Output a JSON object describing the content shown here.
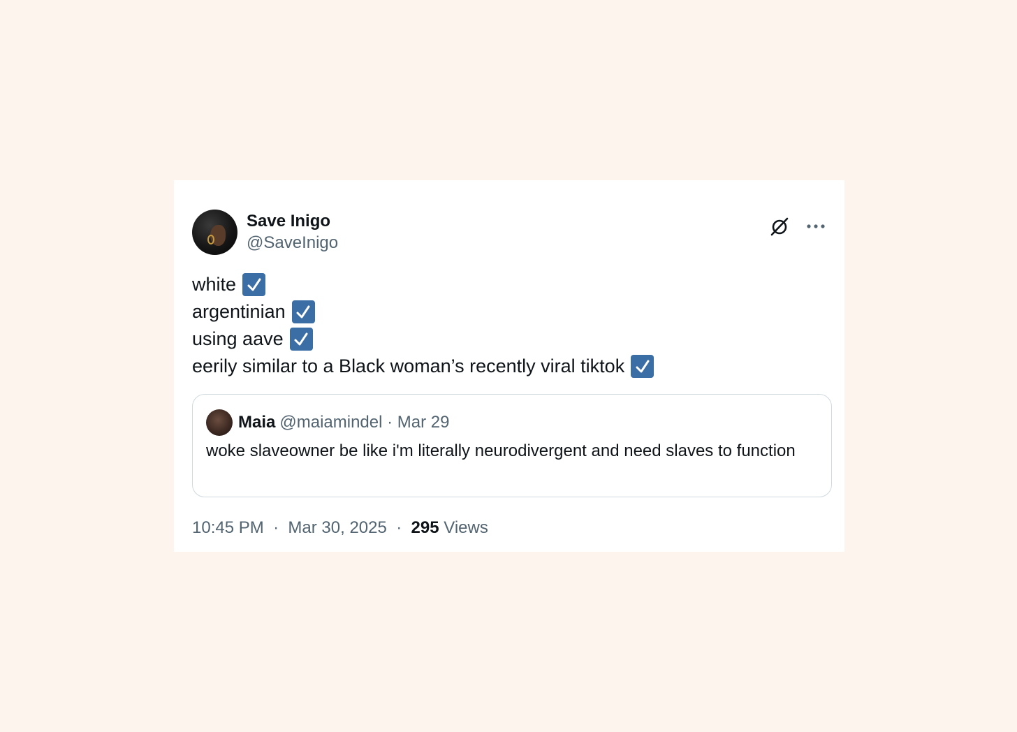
{
  "tweet": {
    "author": {
      "display_name": "Save Inigo",
      "handle": "@SaveInigo"
    },
    "header_icons": [
      "grok-icon",
      "more-icon"
    ],
    "lines": [
      "white",
      "argentinian",
      "using aave",
      "eerily similar to a Black woman’s recently viral tiktok"
    ],
    "line_suffix_icon": "checkbox-checked-icon",
    "quote": {
      "display_name": "Maia",
      "handle": "@maiamindel",
      "separator": "·",
      "date": "Mar 29",
      "text": "woke slaveowner be like i'm literally neurodivergent and need slaves to function"
    },
    "footer": {
      "time": "10:45 PM",
      "separator": "·",
      "date": "Mar 30, 2025",
      "views_count": "295",
      "views_label": "Views"
    }
  },
  "colors": {
    "page_background": "#fdf4ee",
    "card_background": "#ffffff",
    "text_primary": "#0f1419",
    "text_secondary": "#536471",
    "checkbox": "#3b6ea5",
    "quote_border": "#cfd9de"
  }
}
